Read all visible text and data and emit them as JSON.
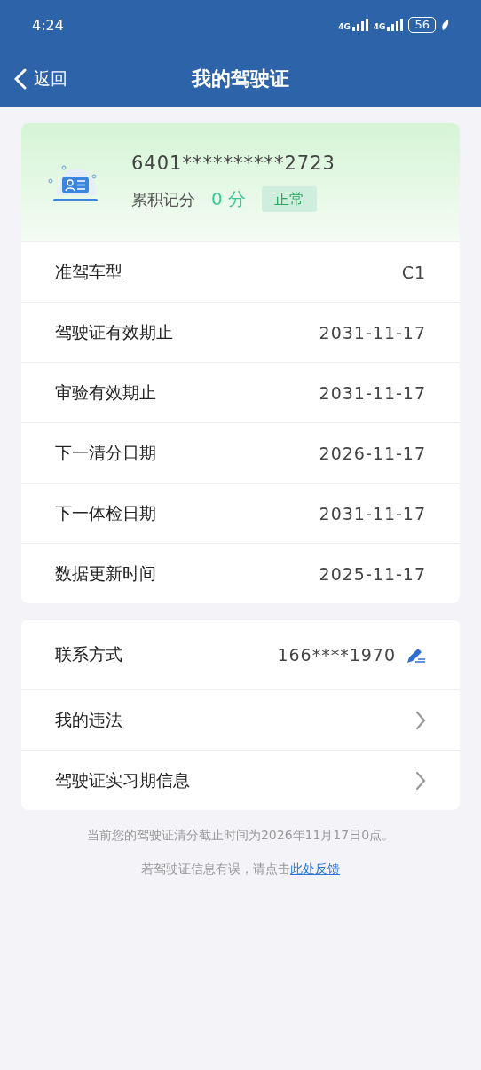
{
  "status_bar": {
    "time": "4:24",
    "network_1": "4G",
    "network_2": "4G",
    "battery": "56"
  },
  "header": {
    "back": "返回",
    "title": "我的驾驶证"
  },
  "license": {
    "number": "6401**********2723",
    "points_label": "累积记分",
    "points": "0 分",
    "status": "正常"
  },
  "details": [
    {
      "label": "准驾车型",
      "value": "C1"
    },
    {
      "label": "驾驶证有效期止",
      "value": "2031-11-17"
    },
    {
      "label": "审验有效期止",
      "value": "2031-11-17"
    },
    {
      "label": "下一清分日期",
      "value": "2026-11-17"
    },
    {
      "label": "下一体检日期",
      "value": "2031-11-17"
    },
    {
      "label": "数据更新时间",
      "value": "2025-11-17"
    }
  ],
  "actions": [
    {
      "kind": "contact",
      "label": "联系方式",
      "value": "166****1970"
    },
    {
      "kind": "link",
      "label": "我的违法"
    },
    {
      "kind": "link",
      "label": "驾驶证实习期信息"
    }
  ],
  "notes": {
    "deadline": "当前您的驾驶证清分截止时间为2026年11月17日0点。",
    "feedback": "若驾驶证信息有误，请点击",
    "feedback_link": "此处反馈"
  }
}
